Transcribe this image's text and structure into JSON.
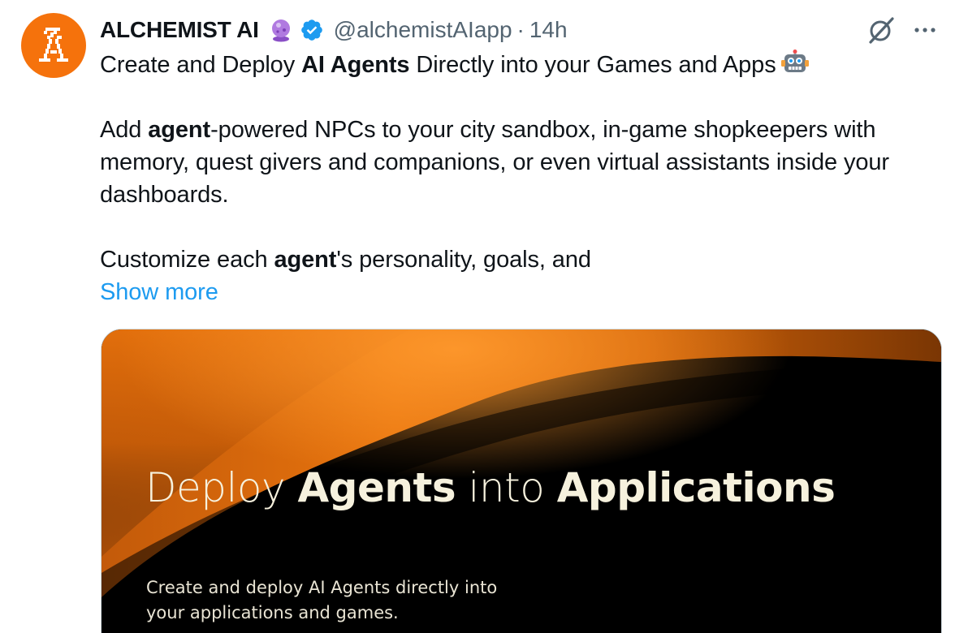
{
  "author": {
    "name": "ALCHEMIST AI",
    "handle": "@alchemistAIapp",
    "separator": "·",
    "time": "14h",
    "avatar_icon": "alchemist-logo-icon",
    "avatar_color": "#f5720c",
    "badges": [
      "crystal-ball-icon",
      "verified-badge-icon"
    ]
  },
  "actions": {
    "grok_icon": "grok-icon",
    "more_icon": "more-options-icon"
  },
  "text": {
    "p1_pre": "Create and Deploy ",
    "p1_bold": "AI Agents",
    "p1_post": " Directly into your Games and Apps",
    "p1_emoji": "robot-icon",
    "p2_pre": "Add ",
    "p2_bold": "agent",
    "p2_post": "-powered NPCs to your city sandbox, in-game shopkeepers with memory, quest givers and companions, or even virtual assistants inside your dashboards.",
    "p3_pre": "Customize each ",
    "p3_bold": "agent",
    "p3_post": "'s personality, goals, and",
    "show_more": "Show more"
  },
  "media": {
    "title_1": "Deploy ",
    "title_2": "Agents",
    "title_3": " into ",
    "title_4": "Applications",
    "subtitle_line1": "Create and deploy AI Agents directly into",
    "subtitle_line2": "your applications and games."
  },
  "colors": {
    "link": "#1d9bf0",
    "secondary_text": "#536471",
    "brand_orange": "#f5720c"
  }
}
